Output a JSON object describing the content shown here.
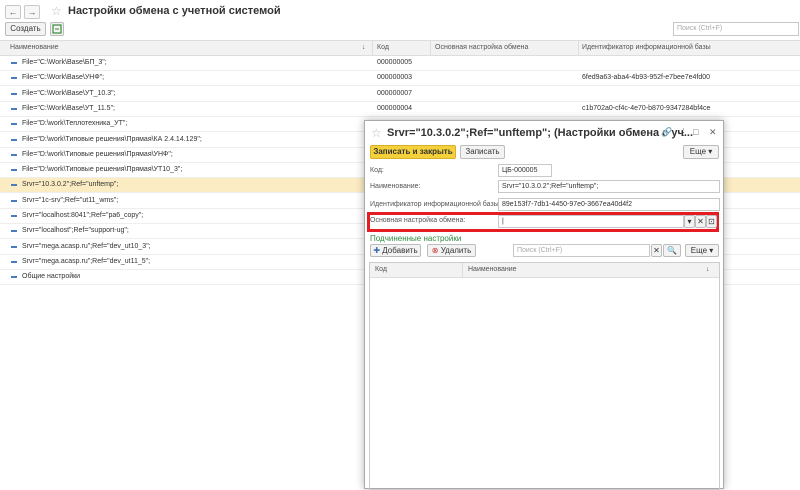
{
  "window": {
    "title": "Настройки обмена с учетной системой",
    "back_label": "←",
    "forward_label": "→"
  },
  "toolbar": {
    "create_label": "Создать",
    "search_placeholder": "Поиск (Ctrl+F)"
  },
  "grid": {
    "columns": {
      "name": "Наименование",
      "code": "Код",
      "main": "Основная настройка обмена",
      "ident": "Идентификатор информационной базы"
    },
    "rows": [
      {
        "name": "File=\"C:\\Work\\Base\\БП_3\";",
        "code": "000000005",
        "ident": ""
      },
      {
        "name": "File=\"C:\\Work\\Base\\УНФ\";",
        "code": "000000003",
        "ident": "6fed9a63-aba4-4b93-952f-e7bee7e4fd00"
      },
      {
        "name": "File=\"C:\\Work\\Base\\УТ_10.3\";",
        "code": "000000007",
        "ident": ""
      },
      {
        "name": "File=\"C:\\Work\\Base\\УТ_11.5\";",
        "code": "000000004",
        "ident": "c1b702a0-cf4c-4e70-b870-9347284bf4ce"
      },
      {
        "name": "File=\"D:\\work\\Теплотехника_УТ\";",
        "code": "",
        "ident": ""
      },
      {
        "name": "File=\"D:\\work\\Типовые решения\\Прямая\\КА 2.4.14.129\";",
        "code": "",
        "ident": ""
      },
      {
        "name": "File=\"D:\\work\\Типовые решения\\Прямая\\УНФ\";",
        "code": "",
        "ident": ""
      },
      {
        "name": "File=\"D:\\work\\Типовые решения\\Прямая\\УТ10_3\";",
        "code": "",
        "ident": ""
      },
      {
        "name": "Srvr=\"10.3.0.2\";Ref=\"unftemp\";",
        "code": "",
        "ident": ""
      },
      {
        "name": "Srvr=\"1c-srv\";Ref=\"ut11_wms\";",
        "code": "",
        "ident": ""
      },
      {
        "name": "Srvr=\"localhost:8041\";Ref=\"ра6_copy\";",
        "code": "",
        "ident": ""
      },
      {
        "name": "Srvr=\"localhost\";Ref=\"support-ug\";",
        "code": "",
        "ident": ""
      },
      {
        "name": "Srvr=\"mega.acasp.ru\";Ref=\"dev_ut10_3\";",
        "code": "",
        "ident": ""
      },
      {
        "name": "Srvr=\"mega.acasp.ru\";Ref=\"dev_ut11_5\";",
        "code": "",
        "ident": ""
      },
      {
        "name": "Общие настройки",
        "code": "",
        "ident": ""
      }
    ]
  },
  "dialog": {
    "title": "Srvr=\"10.3.0.2\";Ref=\"unftemp\"; (Настройки обмена с уч...",
    "save_close": "Записать и закрыть",
    "save": "Записать",
    "more": "Еще",
    "fields": {
      "code_label": "Код:",
      "code_value": "ЦБ-000005",
      "name_label": "Наименование:",
      "name_value": "Srvr=\"10.3.0.2\";Ref=\"unftemp\";",
      "ident_label": "Идентификатор информационной базы:",
      "ident_value": "89e153f7-7db1-4450-97e0-3667ea40d4f2",
      "main_label": "Основная настройка обмена:",
      "main_value": ""
    },
    "sub": {
      "title": "Подчиненные настройки",
      "add": "Добавить",
      "delete": "Удалить",
      "search_placeholder": "Поиск (Ctrl+F)",
      "more": "Еще",
      "col_code": "Код",
      "col_name": "Наименование"
    }
  }
}
